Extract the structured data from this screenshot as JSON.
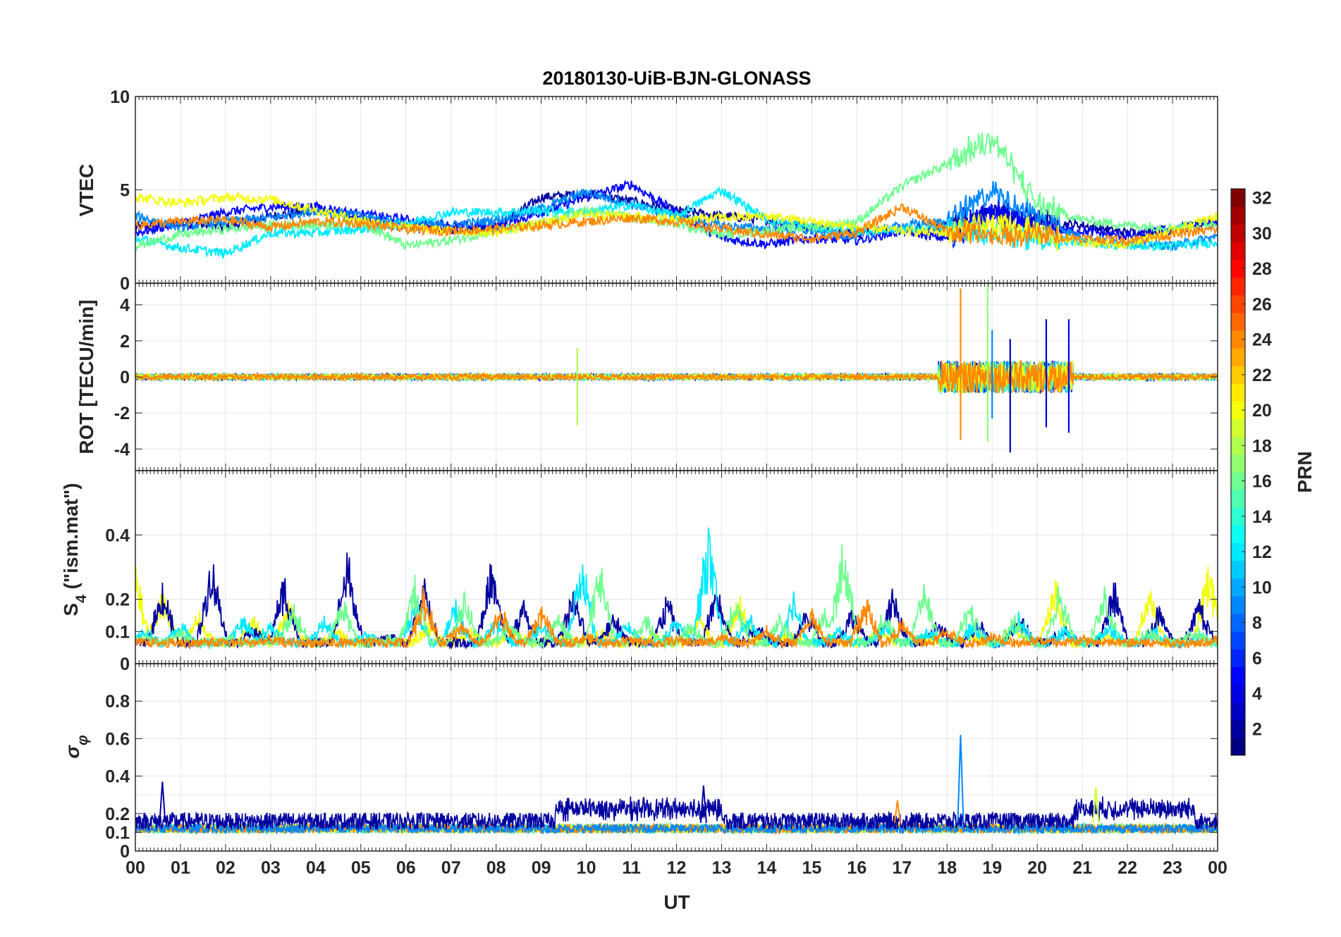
{
  "chart_data": {
    "type": "line",
    "title": "20180130-UiB-BJN-GLONASS",
    "xlabel": "UT",
    "x_ticks": [
      "00",
      "01",
      "02",
      "03",
      "04",
      "05",
      "06",
      "07",
      "08",
      "09",
      "10",
      "11",
      "12",
      "13",
      "14",
      "15",
      "16",
      "17",
      "18",
      "19",
      "20",
      "21",
      "22",
      "23",
      "00"
    ],
    "xlim": [
      0,
      24
    ],
    "grid": true,
    "colorbar": {
      "label": "PRN",
      "colormap": "jet",
      "range": [
        1,
        32
      ],
      "ticks": [
        "2",
        "4",
        "6",
        "8",
        "10",
        "12",
        "14",
        "16",
        "18",
        "20",
        "22",
        "24",
        "26",
        "28",
        "30",
        "32"
      ]
    },
    "panels": [
      {
        "id": "vtec",
        "ylabel": "VTEC",
        "ylim": [
          0,
          10
        ],
        "y_ticks": [
          "0",
          "5",
          "10"
        ],
        "series": [
          {
            "prn": 2,
            "x": [
              0,
              1,
              2,
              3,
              4,
              5,
              6,
              7,
              8,
              9,
              10,
              11,
              12,
              13,
              14,
              15,
              16,
              17,
              18,
              19,
              20,
              21,
              22,
              23,
              24
            ],
            "y": [
              3.0,
              3.2,
              3.0,
              3.6,
              3.9,
              3.4,
              3.0,
              2.9,
              3.0,
              4.6,
              4.8,
              4.4,
              3.9,
              3.6,
              3.4,
              3.0,
              2.7,
              2.9,
              3.0,
              3.8,
              3.3,
              3.1,
              2.7,
              2.9,
              3.3
            ]
          },
          {
            "prn": 5,
            "x": [
              0,
              1,
              2,
              3,
              4,
              5,
              6,
              7,
              8,
              9,
              10,
              11,
              12,
              13,
              14,
              15,
              16,
              17,
              18,
              19,
              20,
              21,
              22,
              23,
              24
            ],
            "y": [
              2.7,
              3.2,
              3.8,
              4.1,
              4.1,
              3.7,
              3.4,
              3.1,
              3.0,
              3.8,
              4.6,
              5.3,
              3.8,
              2.4,
              2.1,
              2.4,
              2.3,
              2.8,
              2.4,
              3.9,
              2.9,
              2.8,
              2.5,
              2.9,
              3.2
            ]
          },
          {
            "prn": 9,
            "x": [
              0,
              1,
              2,
              3,
              4,
              5,
              6,
              7,
              8,
              9,
              10,
              11,
              12,
              13,
              14,
              15,
              16,
              17,
              18,
              19,
              20,
              21,
              22,
              23,
              24
            ],
            "y": [
              3.6,
              3.0,
              3.3,
              3.5,
              3.9,
              3.6,
              3.2,
              3.1,
              3.4,
              4.0,
              4.9,
              4.2,
              3.6,
              3.1,
              2.9,
              2.8,
              2.5,
              3.1,
              3.3,
              4.9,
              3.6,
              2.4,
              2.2,
              2.0,
              2.5
            ]
          },
          {
            "prn": 12,
            "x": [
              0,
              1,
              2,
              3,
              4,
              5,
              6,
              7,
              8,
              9,
              10,
              11,
              12,
              13,
              14,
              15,
              16,
              17,
              18,
              19,
              20,
              21,
              22,
              23,
              24
            ],
            "y": [
              2.4,
              1.9,
              1.6,
              2.7,
              2.7,
              2.9,
              3.2,
              3.8,
              3.8,
              3.9,
              3.8,
              4.2,
              3.6,
              5.0,
              3.4,
              3.0,
              2.8,
              2.9,
              2.9,
              2.7,
              2.4,
              2.2,
              2.0,
              2.0,
              2.2
            ]
          },
          {
            "prn": 16,
            "x": [
              0,
              1,
              2,
              3,
              4,
              5,
              6,
              7,
              8,
              9,
              10,
              11,
              12,
              13,
              14,
              15,
              16,
              17,
              18,
              19,
              20,
              21,
              22,
              23,
              24
            ],
            "y": [
              2.0,
              2.6,
              2.9,
              3.1,
              3.1,
              3.3,
              2.0,
              2.3,
              2.8,
              3.2,
              3.9,
              3.5,
              3.2,
              2.6,
              2.8,
              3.0,
              3.3,
              5.2,
              6.4,
              7.8,
              4.2,
              3.4,
              3.1,
              3.0,
              3.2
            ]
          },
          {
            "prn": 20,
            "x": [
              0,
              1,
              2,
              3,
              4,
              5,
              6,
              7,
              8,
              9,
              10,
              11,
              12,
              13,
              14,
              15,
              16,
              17,
              18,
              19,
              20,
              21,
              22,
              23,
              24
            ],
            "y": [
              4.6,
              4.3,
              4.6,
              4.5,
              3.9,
              3.4,
              3.0,
              2.8,
              2.7,
              3.2,
              3.7,
              3.6,
              3.4,
              3.5,
              3.6,
              3.3,
              3.0,
              2.8,
              2.7,
              3.1,
              2.7,
              2.2,
              2.1,
              2.8,
              3.6
            ]
          },
          {
            "prn": 24,
            "x": [
              0,
              1,
              2,
              3,
              4,
              5,
              6,
              7,
              8,
              9,
              10,
              11,
              12,
              13,
              14,
              15,
              16,
              17,
              18,
              19,
              20,
              21,
              22,
              23,
              24
            ],
            "y": [
              3.1,
              3.3,
              3.4,
              3.0,
              3.3,
              3.2,
              2.9,
              2.8,
              2.9,
              3.1,
              3.3,
              3.5,
              3.3,
              2.9,
              2.6,
              2.4,
              2.7,
              4.1,
              2.8,
              2.5,
              2.6,
              2.4,
              2.3,
              2.6,
              2.9
            ]
          }
        ]
      },
      {
        "id": "rot",
        "ylabel": "ROT [TECU/min]",
        "ylim": [
          -5.2,
          5.2
        ],
        "y_ticks": [
          "-4",
          "-2",
          "0",
          "2",
          "4"
        ],
        "spikes": [
          {
            "prn": 18,
            "x": 9.8,
            "y": [
              1.6,
              -2.7
            ]
          },
          {
            "prn": 24,
            "x": 18.3,
            "y": [
              4.9,
              -3.5
            ]
          },
          {
            "prn": 17,
            "x": 18.9,
            "y": [
              5.3,
              -3.6
            ]
          },
          {
            "prn": 3,
            "x": 19.4,
            "y": [
              2.1,
              -4.2
            ]
          },
          {
            "prn": 4,
            "x": 20.2,
            "y": [
              3.2,
              -2.8
            ]
          },
          {
            "prn": 5,
            "x": 20.7,
            "y": [
              3.2,
              -3.1
            ]
          },
          {
            "prn": 9,
            "x": 19.0,
            "y": [
              2.6,
              -2.3
            ]
          }
        ]
      },
      {
        "id": "s4",
        "ylabel": "S",
        "ylabel_sub": "4",
        "ylabel_suffix": " (\"ism.mat\")",
        "ylim": [
          0,
          0.6
        ],
        "y_ticks": [
          "0",
          "0.1",
          "0.2",
          "0.4"
        ],
        "series_peaks": [
          {
            "prn": 20,
            "x": [
              0.0,
              0.6,
              1.4,
              2.6,
              3.4,
              4.5,
              5.5,
              6.5,
              7.4,
              8.4,
              9.5,
              10.4,
              11.5,
              12.5,
              13.4,
              14.5,
              15.4,
              16.5,
              17.4,
              18.5,
              19.5,
              20.4,
              21.5,
              22.5,
              23.8
            ],
            "y": [
              0.3,
              0.22,
              0.15,
              0.14,
              0.2,
              0.1,
              0.07,
              0.12,
              0.1,
              0.11,
              0.08,
              0.1,
              0.09,
              0.16,
              0.21,
              0.09,
              0.08,
              0.1,
              0.08,
              0.08,
              0.11,
              0.25,
              0.08,
              0.22,
              0.31
            ]
          },
          {
            "prn": 2,
            "x": [
              0.0,
              0.6,
              1.7,
              2.6,
              3.3,
              4.7,
              5.6,
              6.4,
              7.9,
              8.6,
              9.7,
              10.6,
              11.8,
              12.9,
              13.8,
              14.9,
              15.9,
              16.8,
              17.8,
              18.7,
              19.6,
              20.6,
              21.7,
              22.7,
              23.6
            ],
            "y": [
              0.06,
              0.24,
              0.33,
              0.1,
              0.26,
              0.33,
              0.08,
              0.25,
              0.3,
              0.18,
              0.22,
              0.15,
              0.2,
              0.24,
              0.12,
              0.16,
              0.16,
              0.21,
              0.12,
              0.13,
              0.14,
              0.1,
              0.24,
              0.17,
              0.19
            ]
          },
          {
            "prn": 12,
            "x": [
              0.2,
              1.0,
              2.4,
              3.0,
              4.2,
              5.1,
              6.2,
              7.1,
              8.0,
              9.0,
              9.9,
              10.9,
              12.0,
              12.7,
              13.6,
              14.6,
              15.6,
              16.6,
              17.6,
              18.6,
              19.6,
              20.6,
              21.6,
              22.6,
              23.6
            ],
            "y": [
              0.1,
              0.12,
              0.14,
              0.12,
              0.14,
              0.09,
              0.2,
              0.18,
              0.13,
              0.12,
              0.33,
              0.12,
              0.14,
              0.41,
              0.14,
              0.21,
              0.1,
              0.12,
              0.1,
              0.12,
              0.14,
              0.1,
              0.12,
              0.1,
              0.08
            ]
          },
          {
            "prn": 16,
            "x": [
              0.2,
              1.0,
              2.0,
              3.5,
              4.6,
              5.6,
              6.2,
              7.3,
              8.3,
              9.4,
              10.3,
              11.3,
              12.3,
              13.3,
              14.3,
              15.3,
              15.7,
              16.6,
              17.5,
              18.5,
              19.5,
              20.5,
              21.5,
              22.5,
              23.5
            ],
            "y": [
              0.08,
              0.1,
              0.08,
              0.18,
              0.2,
              0.08,
              0.25,
              0.22,
              0.12,
              0.14,
              0.3,
              0.14,
              0.12,
              0.2,
              0.14,
              0.16,
              0.37,
              0.15,
              0.24,
              0.18,
              0.14,
              0.24,
              0.22,
              0.1,
              0.1
            ]
          },
          {
            "prn": 24,
            "x": [
              0.0,
              1.0,
              2.0,
              3.0,
              4.0,
              5.0,
              6.4,
              7.2,
              8.1,
              9.0,
              10.0,
              11.0,
              12.0,
              13.0,
              14.0,
              15.0,
              16.2,
              17.0,
              18.0,
              19.0,
              20.0,
              21.0,
              22.0,
              23.0,
              24.0
            ],
            "y": [
              0.06,
              0.06,
              0.06,
              0.07,
              0.06,
              0.06,
              0.22,
              0.12,
              0.17,
              0.17,
              0.08,
              0.07,
              0.07,
              0.08,
              0.1,
              0.16,
              0.2,
              0.12,
              0.1,
              0.08,
              0.07,
              0.07,
              0.06,
              0.06,
              0.07
            ]
          }
        ]
      },
      {
        "id": "sigma_phi",
        "ylabel": "σ",
        "ylabel_sub": "φ",
        "ylim": [
          0,
          1.0
        ],
        "y_ticks": [
          "0",
          "0.1",
          "0.2",
          "0.4",
          "0.6",
          "0.8"
        ],
        "spikes": [
          {
            "prn": 9,
            "x": 18.3,
            "y": 0.62
          },
          {
            "prn": 2,
            "x": 0.6,
            "y": 0.37
          },
          {
            "prn": 2,
            "x": 12.6,
            "y": 0.35
          },
          {
            "prn": 19,
            "x": 21.3,
            "y": 0.34
          },
          {
            "prn": 24,
            "x": 16.9,
            "y": 0.27
          }
        ],
        "baseline": {
          "low": 0.1,
          "high": 0.2
        }
      }
    ]
  }
}
